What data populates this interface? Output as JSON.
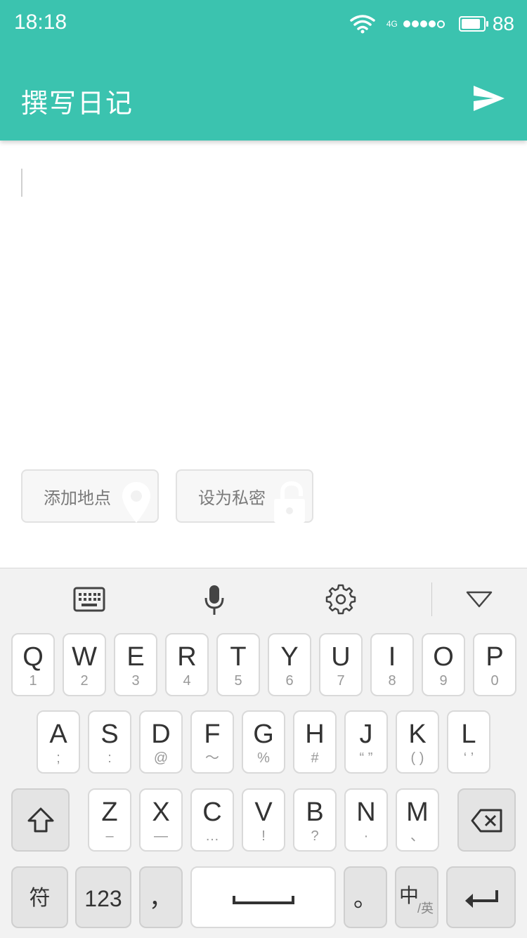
{
  "status": {
    "time": "18:18",
    "network": "4G",
    "battery": "88",
    "battery_level": 0.88
  },
  "header": {
    "title": "撰写日记"
  },
  "chips": {
    "location_label": "添加地点",
    "private_label": "设为私密"
  },
  "keyboard": {
    "row1": [
      {
        "main": "Q",
        "sub": "1"
      },
      {
        "main": "W",
        "sub": "2"
      },
      {
        "main": "E",
        "sub": "3"
      },
      {
        "main": "R",
        "sub": "4"
      },
      {
        "main": "T",
        "sub": "5"
      },
      {
        "main": "Y",
        "sub": "6"
      },
      {
        "main": "U",
        "sub": "7"
      },
      {
        "main": "I",
        "sub": "8"
      },
      {
        "main": "O",
        "sub": "9"
      },
      {
        "main": "P",
        "sub": "0"
      }
    ],
    "row2": [
      {
        "main": "A",
        "sub": ";"
      },
      {
        "main": "S",
        "sub": ":"
      },
      {
        "main": "D",
        "sub": "@"
      },
      {
        "main": "F",
        "sub": "～"
      },
      {
        "main": "G",
        "sub": "%"
      },
      {
        "main": "H",
        "sub": "#"
      },
      {
        "main": "J",
        "sub": "“ ”"
      },
      {
        "main": "K",
        "sub": "( )"
      },
      {
        "main": "L",
        "sub": "‘ ’"
      }
    ],
    "row3": [
      {
        "main": "Z",
        "sub": "–"
      },
      {
        "main": "X",
        "sub": "—"
      },
      {
        "main": "C",
        "sub": "…"
      },
      {
        "main": "V",
        "sub": "!"
      },
      {
        "main": "B",
        "sub": "?"
      },
      {
        "main": "N",
        "sub": "·"
      },
      {
        "main": "M",
        "sub": "、"
      }
    ],
    "symbols_label": "符",
    "numbers_label": "123",
    "comma_label": "，",
    "period_label": "。",
    "lang_main": "中",
    "lang_sub": "/英"
  }
}
